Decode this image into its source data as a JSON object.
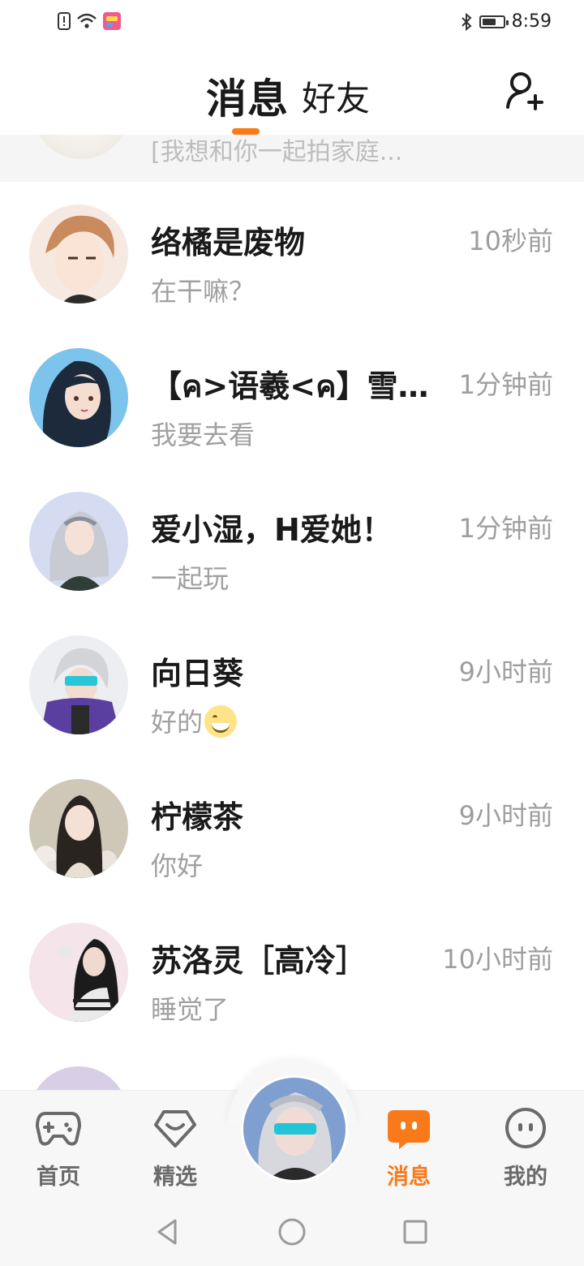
{
  "status_bar": {
    "time": "8:59",
    "icons": [
      "alert-icon",
      "wifi-icon",
      "app-notify-icon",
      "bluetooth-icon",
      "battery-icon"
    ],
    "battery_level": 0.7
  },
  "header": {
    "tabs": [
      {
        "label": "消息",
        "active": true
      },
      {
        "label": "好友",
        "active": false
      }
    ],
    "accent": "#f97a1a"
  },
  "partial_row": {
    "preview": "[我想和你一起拍家庭..."
  },
  "chats": [
    {
      "name": "络橘是废物",
      "time": "10秒前",
      "preview": "在干嘛？"
    },
    {
      "name": "【ค>语羲<ค】雪清...",
      "time": "1分钟前",
      "preview": "我要去看"
    },
    {
      "name": "爱小湿，H爱她！",
      "time": "1分钟前",
      "preview": "一起玩"
    },
    {
      "name": "向日葵",
      "time": "9小时前",
      "preview": "好的",
      "emoji": "grinning-face"
    },
    {
      "name": "柠檬茶",
      "time": "9小时前",
      "preview": "你好"
    },
    {
      "name": "苏洛灵［高冷］",
      "time": "10小时前",
      "preview": "睡觉了"
    }
  ],
  "bottom_nav": {
    "items": [
      {
        "label": "首页",
        "icon": "gamepad-icon"
      },
      {
        "label": "精选",
        "icon": "heart-diamond-icon"
      },
      {
        "label": "消息",
        "icon": "chat-bubble-icon",
        "active": true
      },
      {
        "label": "我的",
        "icon": "smiley-face-icon"
      }
    ]
  },
  "system_nav": [
    "back-icon",
    "home-icon",
    "recents-icon"
  ]
}
